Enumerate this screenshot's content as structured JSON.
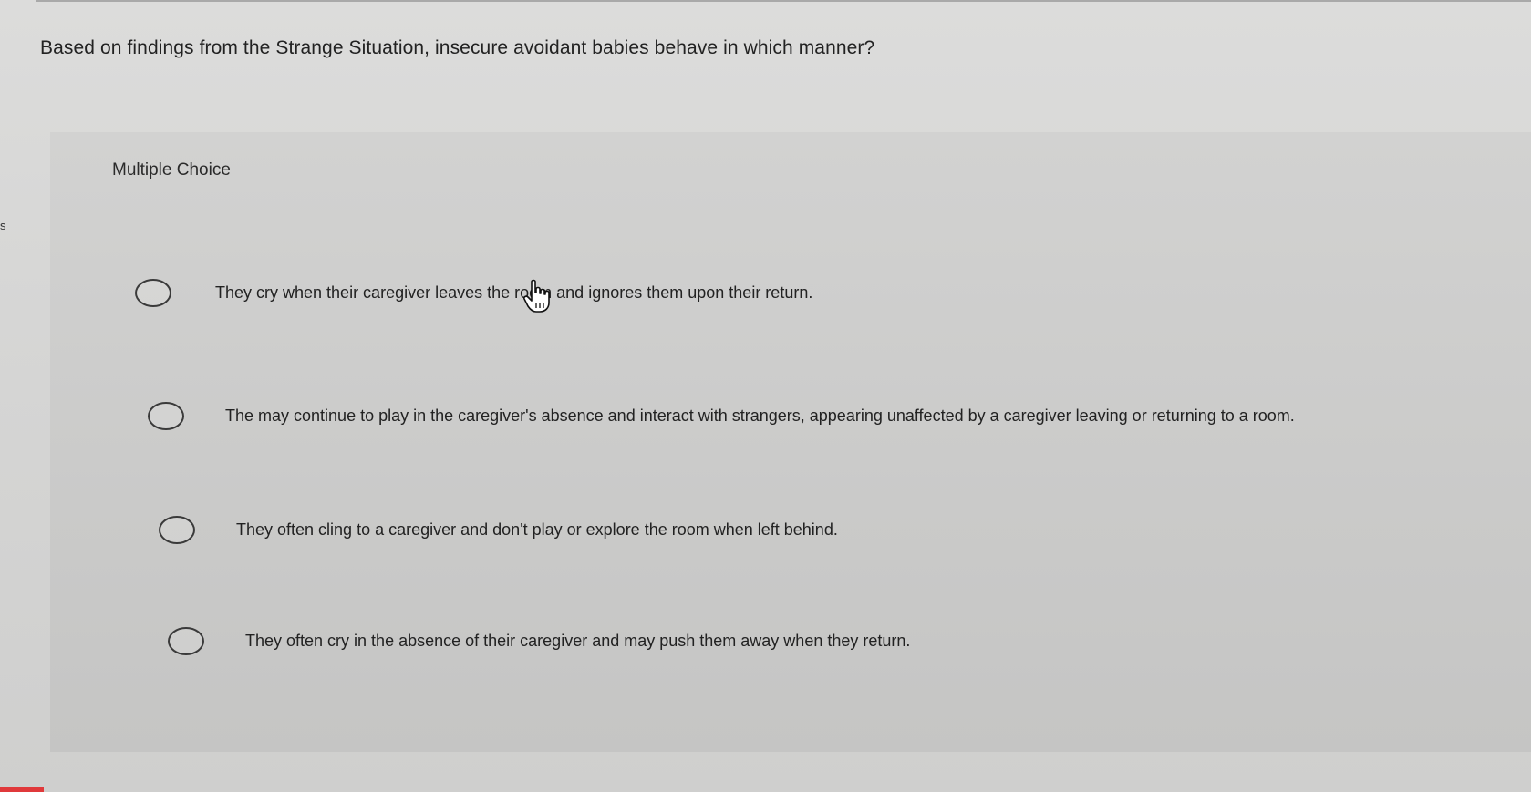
{
  "edge_letter": "s",
  "question": {
    "text": "Based on findings from the Strange Situation, insecure avoidant babies behave in which manner?"
  },
  "question_type": "Multiple Choice",
  "options": [
    {
      "label": "They cry when their caregiver leaves the room and ignores them upon their return."
    },
    {
      "label": "The may continue to play in the caregiver's absence and interact with strangers, appearing unaffected by a caregiver leaving or returning to a room."
    },
    {
      "label": "They often cling to a caregiver and don't play or explore the room when left behind."
    },
    {
      "label": "They often cry in the absence of their caregiver and may push them away when they return."
    }
  ],
  "icons": {
    "cursor": "hand-pointer-icon",
    "radio": "radio-circle-icon"
  },
  "colors": {
    "background": "#d6d6d5",
    "panel": "#cacac9",
    "text": "#222222",
    "accent_red": "#e0393b"
  }
}
